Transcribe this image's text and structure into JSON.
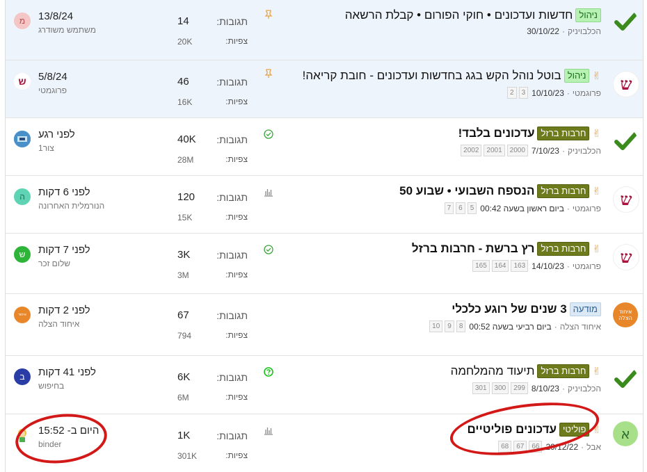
{
  "labels": {
    "replies": "תגובות:",
    "views": "צפיות:"
  },
  "topics": [
    {
      "title": "חדשות ועדכונים • חוקי הפורום • קבלת הרשאה",
      "tag": "ניהול",
      "author": "הכלבויניק",
      "date": "30/10/22",
      "pages": [],
      "status_icon": "pin-icon",
      "replies": "14",
      "views": "20K",
      "last_time": "13/8/24",
      "last_user": "משתמש משודרג",
      "last_avatar_letter": "מ"
    },
    {
      "title": "בוטל נוהל הקש בגג בחדשות ועדכונים - חובת קריאה!",
      "tag": "ניהול",
      "author": "פרוגמטי",
      "date": "10/10/23",
      "pages": [
        "3",
        "2"
      ],
      "status_icon": "pin-icon",
      "replies": "46",
      "views": "16K",
      "last_time": "5/8/24",
      "last_user": "פרוגמטי",
      "last_avatar_letter": "ש"
    },
    {
      "title": "עדכונים בלבד!",
      "tag": "חרבות ברזל",
      "author": "הכלבויניק",
      "date": "7/10/23",
      "pages": [
        "2002",
        "2001",
        "2000"
      ],
      "status_icon": "check-circle-icon",
      "replies": "40K",
      "views": "28M",
      "last_time": "לפני רגע",
      "last_user": "צור1",
      "last_avatar_letter": ""
    },
    {
      "title": "הנספח השבועי • שבוע 50",
      "tag": "חרבות ברזל",
      "author": "פרוגמטי",
      "date": "ביום ראשון בשעה 00:42",
      "pages": [
        "7",
        "6",
        "5"
      ],
      "status_icon": "poll-icon",
      "replies": "120",
      "views": "15K",
      "last_time": "לפני 6 דקות",
      "last_user": "הנורמלית האחרונה",
      "last_avatar_letter": "ה"
    },
    {
      "title": "רץ ברשת - חרבות ברזל",
      "tag": "חרבות ברזל",
      "author": "פרוגמטי",
      "date": "14/10/23",
      "pages": [
        "165",
        "164",
        "163"
      ],
      "status_icon": "check-circle-icon",
      "replies": "3K",
      "views": "3M",
      "last_time": "לפני 7 דקות",
      "last_user": "שלום זכר",
      "last_avatar_letter": "ש"
    },
    {
      "title": "3 שנים של רוגע כלכלי",
      "tag": "מודעה",
      "author": "איחוד הצלה",
      "date": "ביום רביעי בשעה 00:52",
      "pages": [
        "10",
        "9",
        "8"
      ],
      "status_icon": "",
      "replies": "67",
      "views": "794",
      "last_time": "לפני 2 דקות",
      "last_user": "איחוד הצלה",
      "last_avatar_letter": ""
    },
    {
      "title": "תיעוד מהמלחמה",
      "tag": "חרבות ברזל",
      "author": "הכלבויניק",
      "date": "8/10/23",
      "pages": [
        "301",
        "300",
        "299"
      ],
      "status_icon": "question-circle-icon",
      "replies": "6K",
      "views": "6M",
      "last_time": "לפני 41 דקות",
      "last_user": "בחיפוש",
      "last_avatar_letter": "ב"
    },
    {
      "title": "עדכונים פוליטיים",
      "tag": "פוליטי",
      "author": "אבל",
      "date": "29/12/22",
      "pages": [
        "68",
        "67",
        "66"
      ],
      "status_icon": "poll-icon",
      "replies": "1K",
      "views": "301K",
      "last_time": "היום ב- 15:52",
      "last_user": "binder",
      "last_avatar_letter": ""
    }
  ],
  "colors": {
    "pinned_bg": "#eef4fc",
    "green_tag": "#b8f1b4",
    "olive_tag": "#6d7b1c",
    "annotation": "#d31818"
  }
}
